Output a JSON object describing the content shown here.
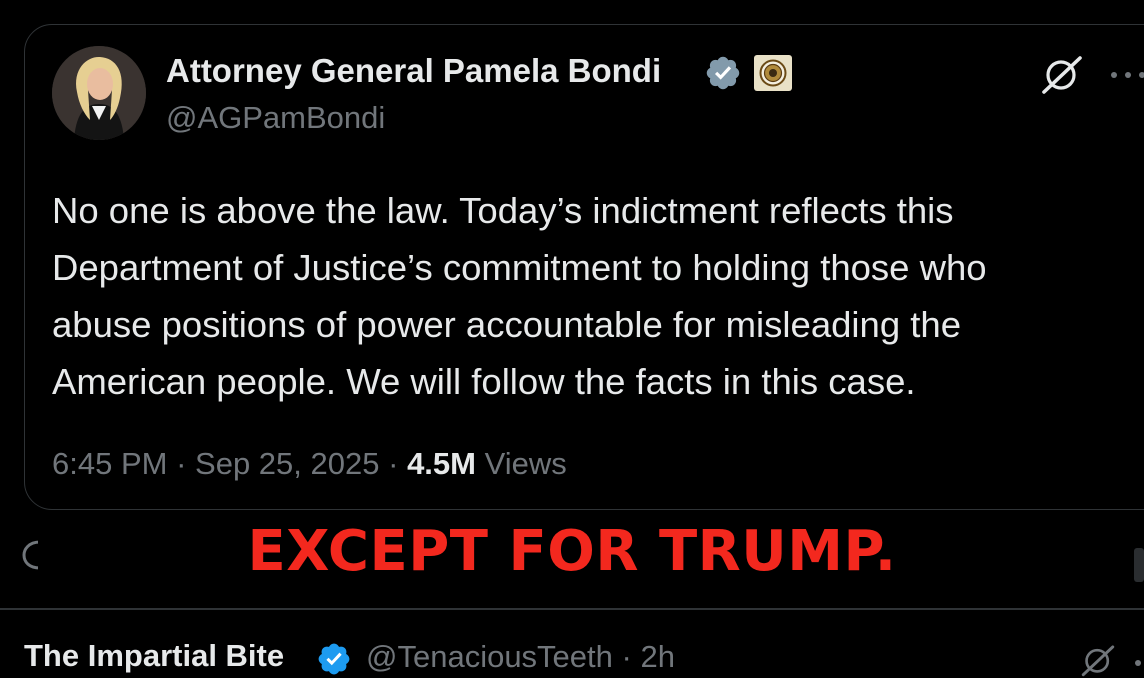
{
  "tweet": {
    "author_name": "Attorney General Pamela Bondi",
    "author_handle": "@AGPamBondi",
    "text": "No one is above the law. Today’s indictment reflects this\nDepartment of Justice’s commitment to holding those who\nabuse positions of power accountable for misleading the\nAmerican people. We will follow the facts in this case.",
    "time": "6:45 PM",
    "date": "Sep 25, 2025",
    "views_count": "4.5M",
    "views_label": "Views",
    "separator": "·"
  },
  "overlay": {
    "text": "EXCEPT FOR TRUMP."
  },
  "reply": {
    "author_name": "The Impartial Bite",
    "author_handle": "@TenaciousTeeth",
    "age": "2h",
    "separator": "·"
  },
  "icons": {
    "verified": "verified-badge-icon",
    "seal": "doj-seal-icon",
    "grok": "grok-icon",
    "more": "more-options-icon"
  },
  "colors": {
    "background": "#000000",
    "text_primary": "#e7e9ea",
    "text_secondary": "#71767b",
    "overlay_red": "#f3281e",
    "verified_gray": "#829aab",
    "verified_blue": "#1d9bf0",
    "border": "#2f3336"
  }
}
